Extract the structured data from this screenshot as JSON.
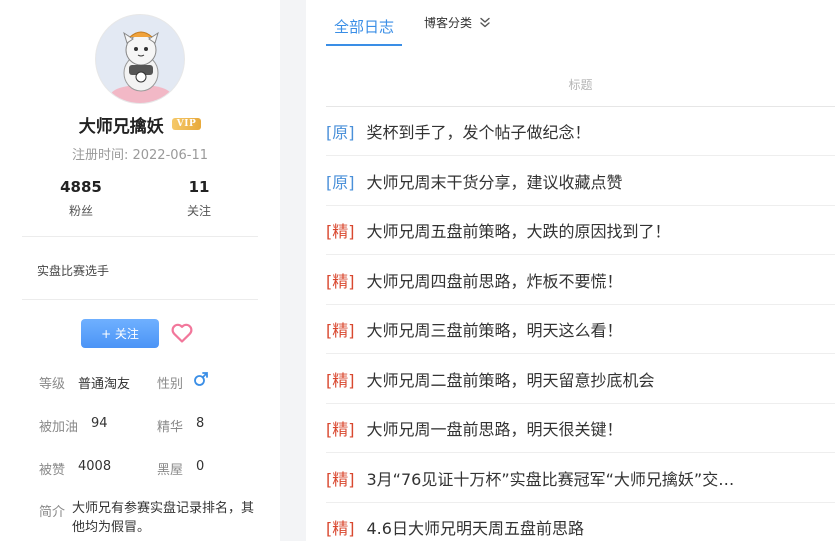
{
  "profile": {
    "username": "大师兄擒妖",
    "vip_label": "VIP",
    "reg_label": "注册时间:",
    "reg_date": "2022-06-11",
    "fans_count": "4885",
    "fans_label": "粉丝",
    "follow_count": "11",
    "follow_label": "关注",
    "tagline": "实盘比赛选手",
    "follow_button": "+ 关注",
    "level_key": "等级",
    "level_val": "普通淘友",
    "gender_key": "性别",
    "boost_key": "被加油",
    "boost_val": "94",
    "essence_key": "精华",
    "essence_val": "8",
    "likes_key": "被赞",
    "likes_val": "4008",
    "blacklist_key": "黑屋",
    "blacklist_val": "0",
    "intro_key": "简介",
    "intro_val": "大师兄有参赛实盘记录排名，其他均为假冒。"
  },
  "tabs": {
    "all": "全部日志",
    "category": "博客分类"
  },
  "list": {
    "header": "标题",
    "posts": [
      {
        "tag": "[原]",
        "type": "orig",
        "title": "奖杯到手了，发个帖子做纪念！"
      },
      {
        "tag": "[原]",
        "type": "orig",
        "title": "大师兄周末干货分享，建议收藏点赞"
      },
      {
        "tag": "[精]",
        "type": "fine",
        "title": "大师兄周五盘前策略，大跌的原因找到了！"
      },
      {
        "tag": "[精]",
        "type": "fine",
        "title": "大师兄周四盘前思路，炸板不要慌！"
      },
      {
        "tag": "[精]",
        "type": "fine",
        "title": "大师兄周三盘前策略，明天这么看！"
      },
      {
        "tag": "[精]",
        "type": "fine",
        "title": "大师兄周二盘前策略，明天留意抄底机会"
      },
      {
        "tag": "[精]",
        "type": "fine",
        "title": "大师兄周一盘前思路，明天很关键！"
      },
      {
        "tag": "[精]",
        "type": "fine",
        "title": "3月“76见证十万杯”实盘比赛冠军“大师兄擒妖”交…"
      },
      {
        "tag": "[精]",
        "type": "fine",
        "title": "4.6日大师兄明天周五盘前思路"
      }
    ]
  },
  "colors": {
    "accent": "#3a8ee6",
    "orig_tag": "#4a90d9",
    "fine_tag": "#d9482f",
    "vip_gold": "#e8a93b",
    "heart_pink": "#f2779b",
    "male_blue": "#3a8ee6"
  },
  "icons": {
    "category_toggle": "double-chevron-down-icon",
    "like": "heart-icon",
    "gender": "male-icon"
  }
}
